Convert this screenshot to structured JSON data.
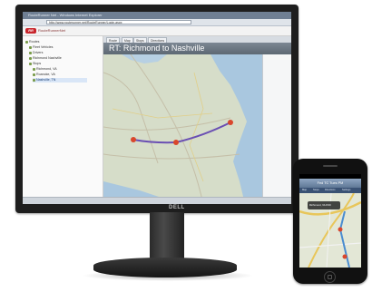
{
  "monitor": {
    "brand": "DELL",
    "browser": {
      "window_title": "RouteRunner Net - Windows Internet Explorer",
      "address": "http://www.routerunner.net/RouteRunner/Login.aspx"
    },
    "app": {
      "logo_text": "RR",
      "name": "RouteRunnerNet"
    },
    "tree": {
      "items": [
        {
          "label": "Routes",
          "indent": 0
        },
        {
          "label": "Fleet Vehicles",
          "indent": 1
        },
        {
          "label": "Drivers",
          "indent": 1
        },
        {
          "label": "Richmond Nashville",
          "indent": 1
        },
        {
          "label": "Stops",
          "indent": 1
        },
        {
          "label": "Richmond, VA",
          "indent": 2
        },
        {
          "label": "Roanoke, VA",
          "indent": 2
        },
        {
          "label": "Nashville, TN",
          "indent": 2
        }
      ],
      "selected_index": 7
    },
    "tabs": [
      "Route",
      "Map",
      "Stops",
      "Directions"
    ],
    "route_title": "RT: Richmond to Nashville"
  },
  "phone": {
    "nav_title": "Fed TC Tues PM",
    "tabs": [
      "Map",
      "Stops",
      "Directions",
      "Settings"
    ],
    "callout": "Richmond, VA 8:00"
  },
  "colors": {
    "route_line": "#6a4fb3",
    "marker": "#d9462c",
    "accent": "#c8252c"
  }
}
